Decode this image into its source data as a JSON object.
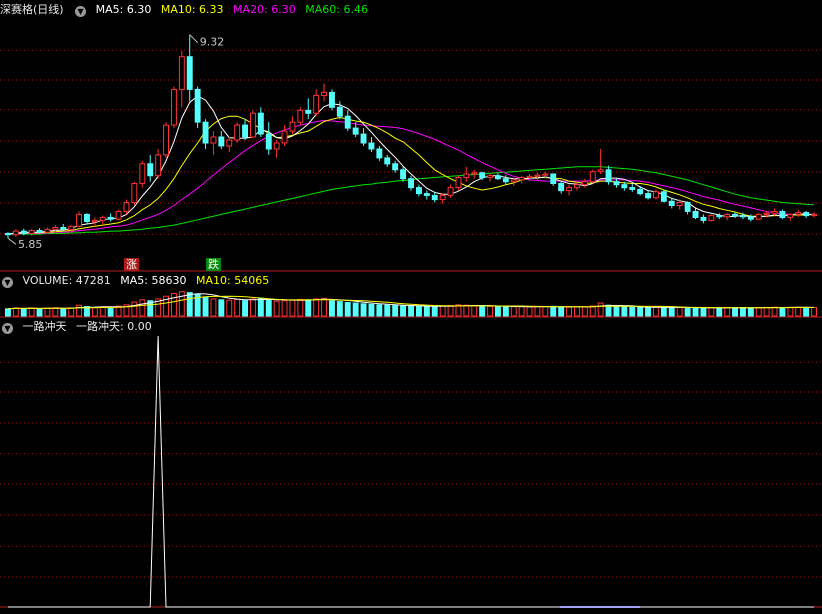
{
  "price_header": {
    "title": "深赛格(日线)",
    "ma5_label": "MA5:",
    "ma5_value": "6.30",
    "ma10_label": "MA10:",
    "ma10_value": "6.33",
    "ma20_label": "MA20:",
    "ma20_value": "6.30",
    "ma60_label": "MA60:",
    "ma60_value": "6.46"
  },
  "volume_header": {
    "label": "VOLUME:",
    "value": "47281",
    "ma5_label": "MA5:",
    "ma5_value": "58630",
    "ma10_label": "MA10:",
    "ma10_value": "54065"
  },
  "indicator_header": {
    "name": "一路冲天",
    "series_label": "一路冲天:",
    "series_value": "0.00"
  },
  "annotations": {
    "high": "9.32",
    "low": "5.85",
    "rise_badge": "涨",
    "fall_badge": "跌"
  },
  "colors": {
    "up": "#ff3232",
    "down": "#54ffff",
    "ma5": "#ffffff",
    "ma10": "#ffff00",
    "ma20": "#ff00ff",
    "ma60": "#00e600",
    "grid": "#a01818",
    "text": "#c8c8c8"
  },
  "chart_data": [
    {
      "type": "candlestick",
      "title": "深赛格(日线)",
      "ylim": [
        5.4,
        9.6
      ],
      "candles": [
        [
          5.98,
          6.0,
          5.9,
          5.96
        ],
        [
          5.96,
          6.05,
          5.92,
          6.02
        ],
        [
          6.02,
          6.06,
          5.95,
          5.98
        ],
        [
          5.98,
          6.05,
          5.94,
          6.03
        ],
        [
          6.03,
          6.07,
          5.98,
          6.0
        ],
        [
          6.0,
          6.08,
          5.97,
          6.05
        ],
        [
          6.05,
          6.12,
          6.0,
          6.08
        ],
        [
          6.08,
          6.14,
          6.02,
          6.05
        ],
        [
          6.05,
          6.12,
          6.0,
          6.1
        ],
        [
          6.1,
          6.35,
          6.08,
          6.3
        ],
        [
          6.3,
          6.32,
          6.15,
          6.18
        ],
        [
          6.18,
          6.25,
          6.1,
          6.2
        ],
        [
          6.2,
          6.28,
          6.12,
          6.25
        ],
        [
          6.25,
          6.32,
          6.18,
          6.22
        ],
        [
          6.22,
          6.38,
          6.2,
          6.35
        ],
        [
          6.35,
          6.55,
          6.3,
          6.5
        ],
        [
          6.5,
          6.85,
          6.45,
          6.82
        ],
        [
          6.82,
          7.2,
          6.75,
          7.15
        ],
        [
          7.15,
          7.3,
          6.85,
          6.95
        ],
        [
          6.95,
          7.4,
          6.9,
          7.3
        ],
        [
          7.3,
          7.85,
          7.25,
          7.8
        ],
        [
          7.8,
          8.45,
          7.75,
          8.4
        ],
        [
          8.4,
          9.05,
          8.1,
          8.95
        ],
        [
          8.95,
          9.32,
          8.2,
          8.4
        ],
        [
          8.4,
          8.45,
          7.75,
          7.85
        ],
        [
          7.85,
          7.9,
          7.4,
          7.5
        ],
        [
          7.5,
          7.7,
          7.3,
          7.6
        ],
        [
          7.6,
          7.7,
          7.4,
          7.45
        ],
        [
          7.45,
          7.6,
          7.35,
          7.55
        ],
        [
          7.55,
          7.85,
          7.5,
          7.8
        ],
        [
          7.8,
          7.9,
          7.55,
          7.6
        ],
        [
          7.6,
          8.05,
          7.58,
          8.0
        ],
        [
          8.0,
          8.1,
          7.6,
          7.65
        ],
        [
          7.65,
          7.85,
          7.3,
          7.4
        ],
        [
          7.4,
          7.55,
          7.25,
          7.5
        ],
        [
          7.5,
          7.8,
          7.45,
          7.7
        ],
        [
          7.7,
          7.95,
          7.65,
          7.85
        ],
        [
          7.85,
          8.1,
          7.8,
          8.05
        ],
        [
          8.05,
          8.25,
          7.9,
          8.0
        ],
        [
          8.0,
          8.4,
          7.95,
          8.3
        ],
        [
          8.3,
          8.5,
          8.2,
          8.35
        ],
        [
          8.35,
          8.4,
          8.05,
          8.1
        ],
        [
          8.1,
          8.2,
          7.9,
          7.95
        ],
        [
          7.95,
          8.05,
          7.7,
          7.75
        ],
        [
          7.75,
          7.85,
          7.6,
          7.65
        ],
        [
          7.65,
          7.75,
          7.45,
          7.5
        ],
        [
          7.5,
          7.6,
          7.35,
          7.4
        ],
        [
          7.4,
          7.45,
          7.2,
          7.25
        ],
        [
          7.25,
          7.3,
          7.1,
          7.15
        ],
        [
          7.15,
          7.2,
          7.0,
          7.05
        ],
        [
          7.05,
          7.1,
          6.85,
          6.9
        ],
        [
          6.9,
          6.95,
          6.7,
          6.75
        ],
        [
          6.75,
          6.8,
          6.6,
          6.65
        ],
        [
          6.65,
          6.7,
          6.55,
          6.62
        ],
        [
          6.62,
          6.68,
          6.5,
          6.55
        ],
        [
          6.55,
          6.65,
          6.48,
          6.62
        ],
        [
          6.62,
          6.8,
          6.58,
          6.75
        ],
        [
          6.75,
          6.95,
          6.7,
          6.92
        ],
        [
          6.92,
          7.1,
          6.85,
          6.98
        ],
        [
          6.98,
          7.05,
          6.9,
          7.0
        ],
        [
          7.0,
          7.02,
          6.88,
          6.92
        ],
        [
          6.92,
          6.98,
          6.85,
          6.95
        ],
        [
          6.95,
          7.0,
          6.88,
          6.9
        ],
        [
          6.9,
          6.96,
          6.8,
          6.85
        ],
        [
          6.85,
          6.92,
          6.78,
          6.88
        ],
        [
          6.88,
          6.95,
          6.82,
          6.92
        ],
        [
          6.92,
          6.98,
          6.86,
          6.94
        ],
        [
          6.94,
          7.0,
          6.88,
          6.96
        ],
        [
          6.96,
          7.02,
          6.9,
          6.98
        ],
        [
          6.98,
          6.99,
          6.78,
          6.82
        ],
        [
          6.82,
          6.85,
          6.65,
          6.7
        ],
        [
          6.7,
          6.8,
          6.62,
          6.75
        ],
        [
          6.75,
          6.85,
          6.7,
          6.8
        ],
        [
          6.8,
          6.9,
          6.75,
          6.85
        ],
        [
          6.85,
          7.05,
          6.82,
          7.02
        ],
        [
          7.02,
          7.4,
          6.98,
          7.05
        ],
        [
          7.05,
          7.12,
          6.8,
          6.85
        ],
        [
          6.85,
          6.9,
          6.75,
          6.8
        ],
        [
          6.8,
          6.85,
          6.7,
          6.75
        ],
        [
          6.75,
          6.82,
          6.68,
          6.72
        ],
        [
          6.72,
          6.78,
          6.62,
          6.65
        ],
        [
          6.65,
          6.7,
          6.55,
          6.58
        ],
        [
          6.58,
          6.72,
          6.55,
          6.68
        ],
        [
          6.68,
          6.72,
          6.5,
          6.52
        ],
        [
          6.52,
          6.58,
          6.4,
          6.45
        ],
        [
          6.45,
          6.55,
          6.38,
          6.5
        ],
        [
          6.5,
          6.52,
          6.3,
          6.35
        ],
        [
          6.35,
          6.4,
          6.22,
          6.25
        ],
        [
          6.25,
          6.3,
          6.15,
          6.2
        ],
        [
          6.2,
          6.3,
          6.18,
          6.28
        ],
        [
          6.28,
          6.32,
          6.22,
          6.26
        ],
        [
          6.26,
          6.32,
          6.2,
          6.3
        ],
        [
          6.3,
          6.34,
          6.24,
          6.28
        ],
        [
          6.28,
          6.33,
          6.22,
          6.26
        ],
        [
          6.26,
          6.3,
          6.18,
          6.22
        ],
        [
          6.22,
          6.32,
          6.2,
          6.3
        ],
        [
          6.3,
          6.36,
          6.25,
          6.32
        ],
        [
          6.32,
          6.4,
          6.28,
          6.35
        ],
        [
          6.35,
          6.38,
          6.22,
          6.25
        ],
        [
          6.25,
          6.32,
          6.2,
          6.3
        ],
        [
          6.3,
          6.38,
          6.26,
          6.33
        ],
        [
          6.33,
          6.36,
          6.24,
          6.28
        ],
        [
          6.28,
          6.34,
          6.25,
          6.3
        ]
      ],
      "ma5": [
        5.97,
        5.99,
        6.0,
        6.0,
        6.0,
        6.02,
        6.03,
        6.04,
        6.06,
        6.12,
        6.14,
        6.16,
        6.21,
        6.23,
        6.24,
        6.3,
        6.43,
        6.61,
        6.76,
        6.94,
        7.2,
        7.52,
        7.92,
        8.18,
        8.29,
        8.22,
        8.04,
        7.76,
        7.59,
        7.58,
        7.58,
        7.6,
        7.72,
        7.69,
        7.59,
        7.57,
        7.62,
        7.71,
        7.82,
        7.98,
        8.11,
        8.16,
        8.14,
        8.08,
        7.96,
        7.82,
        7.68,
        7.53,
        7.39,
        7.26,
        7.11,
        6.98,
        6.86,
        6.74,
        6.67,
        6.64,
        6.64,
        6.69,
        6.76,
        6.85,
        6.91,
        6.95,
        6.95,
        6.92,
        6.9,
        6.9,
        6.91,
        6.91,
        6.93,
        6.9,
        6.86,
        6.82,
        6.81,
        6.78,
        6.82,
        6.9,
        6.91,
        6.91,
        6.89,
        6.84,
        6.76,
        6.7,
        6.68,
        6.63,
        6.57,
        6.53,
        6.5,
        6.41,
        6.35,
        6.32,
        6.29,
        6.26,
        6.27,
        6.28,
        6.26,
        6.26,
        6.27,
        6.29,
        6.28,
        6.29,
        6.31,
        6.3,
        6.3
      ],
      "ma10": [
        5.97,
        5.98,
        5.99,
        5.99,
        5.99,
        6.0,
        6.01,
        6.02,
        6.03,
        6.06,
        6.08,
        6.1,
        6.12,
        6.14,
        6.16,
        6.21,
        6.28,
        6.38,
        6.46,
        6.57,
        6.72,
        6.9,
        7.12,
        7.32,
        7.5,
        7.7,
        7.82,
        7.91,
        7.95,
        7.95,
        7.9,
        7.82,
        7.74,
        7.66,
        7.59,
        7.6,
        7.63,
        7.67,
        7.7,
        7.78,
        7.86,
        7.9,
        7.93,
        7.9,
        7.87,
        7.85,
        7.8,
        7.74,
        7.67,
        7.58,
        7.52,
        7.41,
        7.3,
        7.17,
        7.05,
        6.97,
        6.9,
        6.84,
        6.78,
        6.74,
        6.71,
        6.73,
        6.76,
        6.8,
        6.83,
        6.88,
        6.91,
        6.92,
        6.92,
        6.91,
        6.9,
        6.86,
        6.84,
        6.82,
        6.83,
        6.86,
        6.86,
        6.84,
        6.83,
        6.82,
        6.82,
        6.8,
        6.76,
        6.71,
        6.67,
        6.63,
        6.58,
        6.52,
        6.47,
        6.44,
        6.4,
        6.37,
        6.34,
        6.3,
        6.27,
        6.27,
        6.27,
        6.28,
        6.28,
        6.29,
        6.29,
        6.29,
        6.3
      ],
      "ma20": [
        5.97,
        5.97,
        5.98,
        5.98,
        5.98,
        5.99,
        6.0,
        6.0,
        6.01,
        6.03,
        6.04,
        6.05,
        6.07,
        6.09,
        6.1,
        6.12,
        6.16,
        6.21,
        6.25,
        6.3,
        6.37,
        6.45,
        6.55,
        6.64,
        6.74,
        6.85,
        6.96,
        7.07,
        7.17,
        7.27,
        7.37,
        7.46,
        7.54,
        7.61,
        7.67,
        7.72,
        7.76,
        7.8,
        7.83,
        7.86,
        7.88,
        7.87,
        7.86,
        7.84,
        7.82,
        7.8,
        7.79,
        7.78,
        7.77,
        7.76,
        7.74,
        7.7,
        7.66,
        7.61,
        7.56,
        7.5,
        7.44,
        7.38,
        7.31,
        7.24,
        7.17,
        7.11,
        7.05,
        6.99,
        6.94,
        6.91,
        6.88,
        6.87,
        6.86,
        6.86,
        6.86,
        6.86,
        6.86,
        6.86,
        6.87,
        6.88,
        6.88,
        6.88,
        6.88,
        6.87,
        6.86,
        6.84,
        6.81,
        6.78,
        6.75,
        6.72,
        6.68,
        6.64,
        6.6,
        6.57,
        6.54,
        6.5,
        6.47,
        6.44,
        6.41,
        6.38,
        6.35,
        6.33,
        6.31,
        6.3,
        6.3,
        6.3,
        6.3
      ],
      "ma60": [
        5.97,
        5.97,
        5.97,
        5.97,
        5.97,
        5.98,
        5.98,
        5.98,
        5.99,
        5.99,
        6.0,
        6.0,
        6.01,
        6.02,
        6.02,
        6.03,
        6.04,
        6.05,
        6.07,
        6.08,
        6.1,
        6.12,
        6.15,
        6.18,
        6.21,
        6.24,
        6.27,
        6.3,
        6.33,
        6.36,
        6.39,
        6.42,
        6.45,
        6.48,
        6.51,
        6.54,
        6.57,
        6.6,
        6.63,
        6.66,
        6.69,
        6.72,
        6.74,
        6.76,
        6.78,
        6.8,
        6.81,
        6.83,
        6.84,
        6.86,
        6.87,
        6.88,
        6.9,
        6.91,
        6.92,
        6.93,
        6.94,
        6.95,
        6.96,
        6.97,
        6.98,
        6.99,
        7.0,
        7.01,
        7.02,
        7.03,
        7.04,
        7.05,
        7.06,
        7.07,
        7.08,
        7.09,
        7.1,
        7.1,
        7.1,
        7.1,
        7.09,
        7.08,
        7.07,
        7.06,
        7.04,
        7.02,
        7.0,
        6.97,
        6.94,
        6.91,
        6.88,
        6.84,
        6.8,
        6.76,
        6.72,
        6.68,
        6.64,
        6.61,
        6.58,
        6.56,
        6.54,
        6.52,
        6.5,
        6.49,
        6.48,
        6.47,
        6.46
      ]
    },
    {
      "type": "bar",
      "title": "VOLUME",
      "ylim": [
        0,
        150000
      ],
      "values": [
        40000,
        45000,
        42000,
        44000,
        41000,
        43000,
        46000,
        42000,
        45000,
        60000,
        52000,
        48000,
        50000,
        47000,
        55000,
        62000,
        78000,
        90000,
        85000,
        95000,
        110000,
        125000,
        135000,
        130000,
        120000,
        105000,
        95000,
        90000,
        88000,
        92000,
        85000,
        95000,
        98000,
        90000,
        82000,
        85000,
        88000,
        92000,
        90000,
        95000,
        98000,
        85000,
        80000,
        75000,
        72000,
        68000,
        65000,
        62000,
        60000,
        58000,
        56000,
        55000,
        54000,
        53000,
        52000,
        55000,
        58000,
        62000,
        60000,
        57000,
        55000,
        54000,
        52000,
        53000,
        51000,
        52000,
        50000,
        51000,
        52000,
        54000,
        50000,
        49000,
        50000,
        51000,
        56000,
        72000,
        60000,
        52000,
        50000,
        49000,
        48000,
        47000,
        49000,
        48000,
        47000,
        48000,
        46000,
        45000,
        44000,
        46000,
        45000,
        46000,
        47000,
        46000,
        45000,
        47000,
        48000,
        49000,
        47000,
        48000,
        49000,
        48000,
        47281
      ]
    },
    {
      "type": "line",
      "title": "一路冲天",
      "ylim": [
        0,
        1
      ],
      "series": [
        {
          "name": "一路冲天",
          "nonzero_index": 19,
          "nonzero_value": 1
        }
      ]
    }
  ]
}
